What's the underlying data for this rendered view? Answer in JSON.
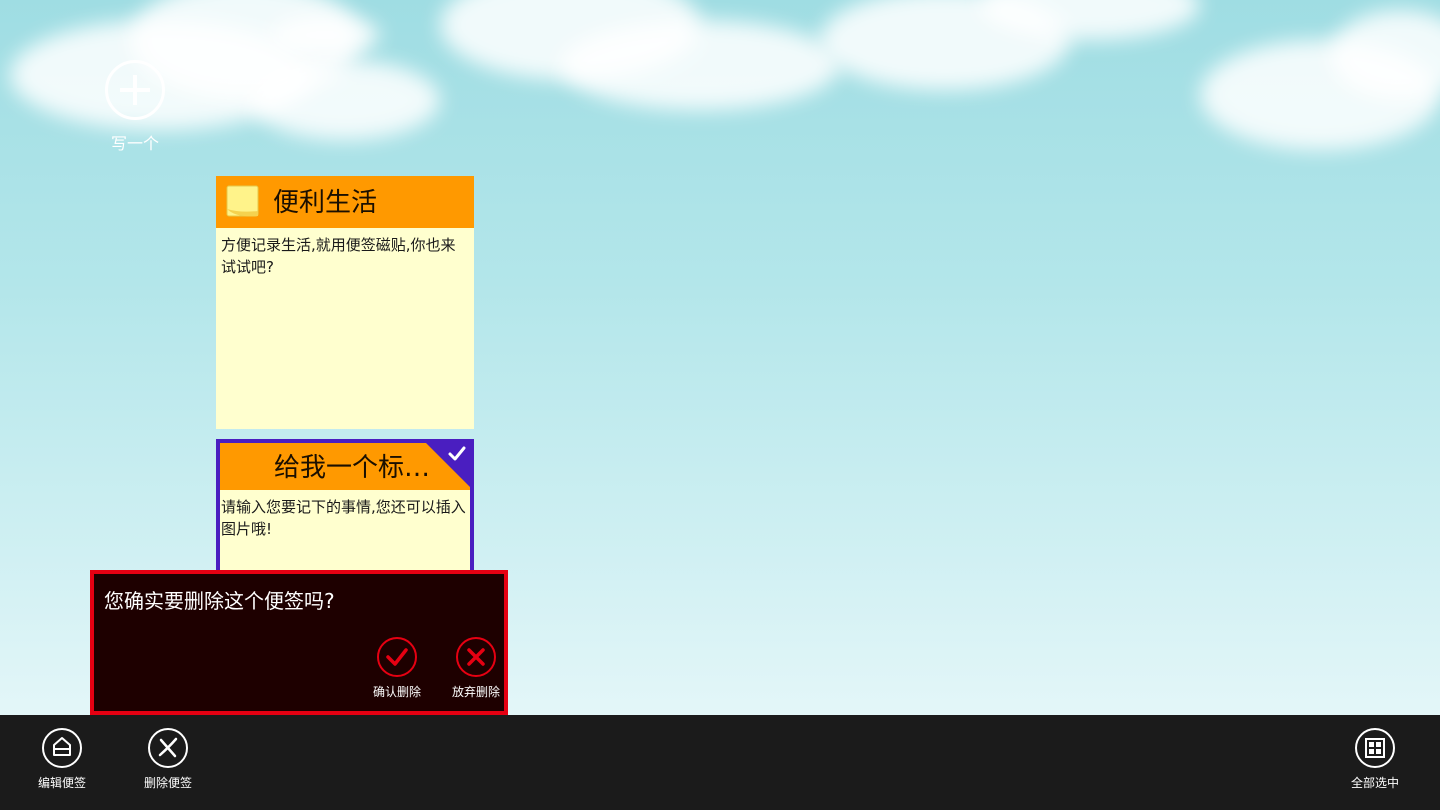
{
  "add_new": {
    "label": "写一个",
    "icon": "plus-circle-icon"
  },
  "notes": [
    {
      "title": "便利生活",
      "body": "方便记录生活,就用便签磁贴,你也来试试吧?",
      "icon": "sticky-note-icon",
      "selected": false
    },
    {
      "title": "给我一个标题...",
      "body": "请输入您要记下的事情,您还可以插入图片哦!",
      "selected": true
    }
  ],
  "dialog": {
    "message": "您确实要删除这个便签吗?",
    "confirm_label": "确认删除",
    "cancel_label": "放弃删除"
  },
  "appbar": {
    "edit_label": "编辑便签",
    "delete_label": "删除便签",
    "select_all_label": "全部选中"
  },
  "colors": {
    "note_header": "#ff9900",
    "note_body": "#ffffcf",
    "selection": "#4a1ec0",
    "dialog_border": "#e60012",
    "dialog_bg": "#1e0000",
    "appbar_bg": "#1b1b1b"
  }
}
